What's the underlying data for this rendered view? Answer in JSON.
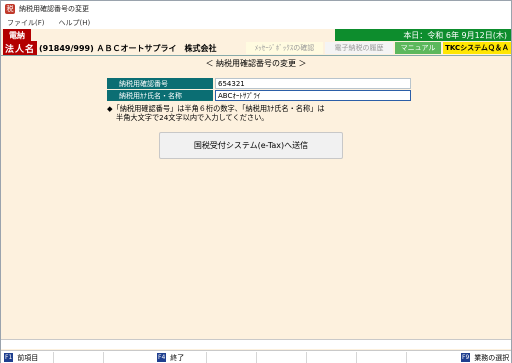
{
  "window": {
    "title": "納税用確認番号の変更"
  },
  "menu": [
    {
      "label": "ファイル(F)"
    },
    {
      "label": "ヘルプ(H)"
    }
  ],
  "header": {
    "dennou_badge": "電納",
    "date_text": "本日：令和 6年 9月12日(木)",
    "corp_label": "法人名",
    "corp_name": "(91849/999) ＡＢＣオートサプライ　株式会社",
    "btn_message": "ﾒｯｾｰｼﾞﾎﾞｯｸｽの確認",
    "btn_history": "電子納税の履歴",
    "btn_manual": "マニュアル",
    "btn_tkc": "TKCシステムＱ＆Ａ"
  },
  "screen": {
    "title": "＜ 納税用確認番号の変更 ＞"
  },
  "form": {
    "confirm_no_label": "納税用確認番号",
    "confirm_no_value": "654321",
    "kana_name_label": "納税用ｶﾅ氏名・名称",
    "kana_name_value": "ABCｵｰﾄｻﾌﾟﾗｲ"
  },
  "note": {
    "line1": "◆「納税用確認番号」は半角６桁の数字、「納税用ｶﾅ氏名・名称」は",
    "line2": "半角大文字で24文字以内で入力してください。"
  },
  "actions": {
    "send_label": "国税受付システム(e-Tax)へ送信"
  },
  "fkeys": [
    {
      "key": "F1",
      "label": "前項目"
    },
    {
      "key": "F4",
      "label": "終了"
    },
    {
      "key": "F9",
      "label": "業務の選択"
    }
  ],
  "colors": {
    "bg": "#fdf1de",
    "dennou_red": "#b30000",
    "date_green": "#0d8d2d",
    "label_teal": "#0b6e73",
    "manual_green": "#5cb85c",
    "tkc_yellow": "#ffe600"
  }
}
